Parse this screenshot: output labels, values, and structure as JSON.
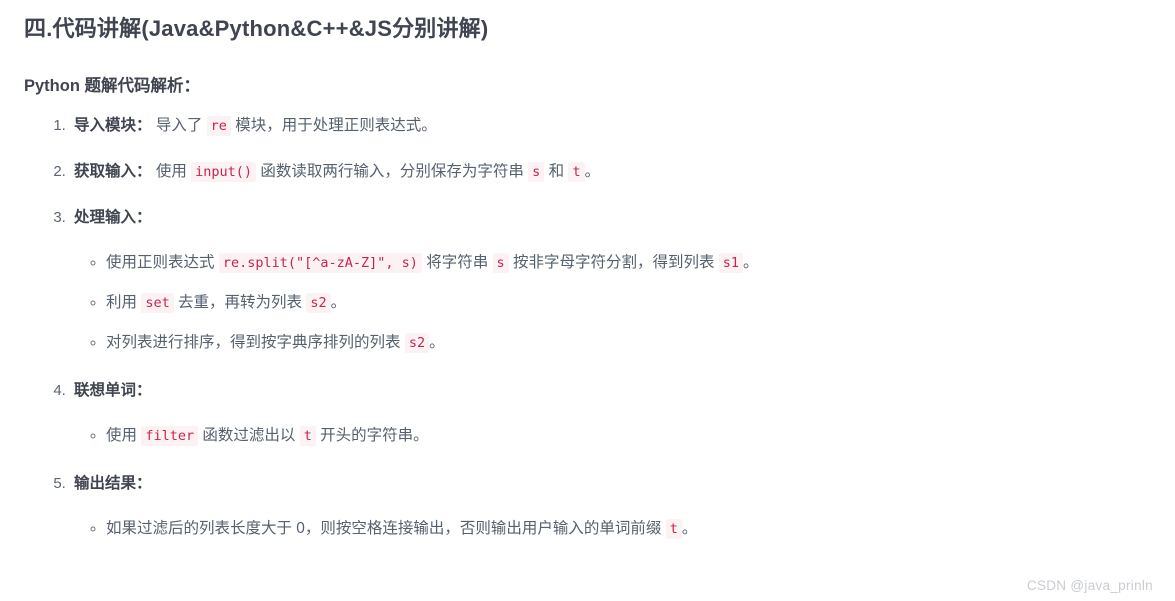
{
  "document": {
    "section_title": "四.代码讲解(Java&Python&C++&JS分别讲解)",
    "sub_title": "Python 题解代码解析：",
    "steps": [
      {
        "lead": "导入模块：",
        "parts": [
          {
            "type": "text",
            "value": " 导入了 "
          },
          {
            "type": "code",
            "value": "re"
          },
          {
            "type": "text",
            "value": " 模块，用于处理正则表达式。"
          }
        ],
        "substeps": []
      },
      {
        "lead": "获取输入：",
        "parts": [
          {
            "type": "text",
            "value": " 使用 "
          },
          {
            "type": "code",
            "value": "input()"
          },
          {
            "type": "text",
            "value": " 函数读取两行输入，分别保存为字符串 "
          },
          {
            "type": "code",
            "value": "s"
          },
          {
            "type": "text",
            "value": " 和 "
          },
          {
            "type": "code",
            "value": "t"
          },
          {
            "type": "text",
            "value": "。"
          }
        ],
        "substeps": []
      },
      {
        "lead": "处理输入：",
        "parts": [],
        "substeps": [
          [
            {
              "type": "text",
              "value": "使用正则表达式 "
            },
            {
              "type": "code",
              "value": "re.split(\"[^a-zA-Z]\", s)"
            },
            {
              "type": "text",
              "value": " 将字符串 "
            },
            {
              "type": "code",
              "value": "s"
            },
            {
              "type": "text",
              "value": " 按非字母字符分割，得到列表 "
            },
            {
              "type": "code",
              "value": "s1"
            },
            {
              "type": "text",
              "value": "。"
            }
          ],
          [
            {
              "type": "text",
              "value": "利用 "
            },
            {
              "type": "code",
              "value": "set"
            },
            {
              "type": "text",
              "value": " 去重，再转为列表 "
            },
            {
              "type": "code",
              "value": "s2"
            },
            {
              "type": "text",
              "value": "。"
            }
          ],
          [
            {
              "type": "text",
              "value": "对列表进行排序，得到按字典序排列的列表 "
            },
            {
              "type": "code",
              "value": "s2"
            },
            {
              "type": "text",
              "value": "。"
            }
          ]
        ]
      },
      {
        "lead": "联想单词：",
        "parts": [],
        "substeps": [
          [
            {
              "type": "text",
              "value": "使用 "
            },
            {
              "type": "code",
              "value": "filter"
            },
            {
              "type": "text",
              "value": " 函数过滤出以 "
            },
            {
              "type": "code",
              "value": "t"
            },
            {
              "type": "text",
              "value": " 开头的字符串。"
            }
          ]
        ]
      },
      {
        "lead": "输出结果：",
        "parts": [],
        "substeps": [
          [
            {
              "type": "text",
              "value": "如果过滤后的列表长度大于 0，则按空格连接输出，否则输出用户输入的单词前缀 "
            },
            {
              "type": "code",
              "value": "t"
            },
            {
              "type": "text",
              "value": "。"
            }
          ]
        ]
      }
    ],
    "watermark": "CSDN @java_prinln",
    "colors": {
      "heading": "#3f4450",
      "body": "#56616f",
      "code_text": "#c7254e",
      "code_background": "#fcf2f4",
      "watermark": "#c9ccd1",
      "page_background": "#ffffff"
    }
  }
}
